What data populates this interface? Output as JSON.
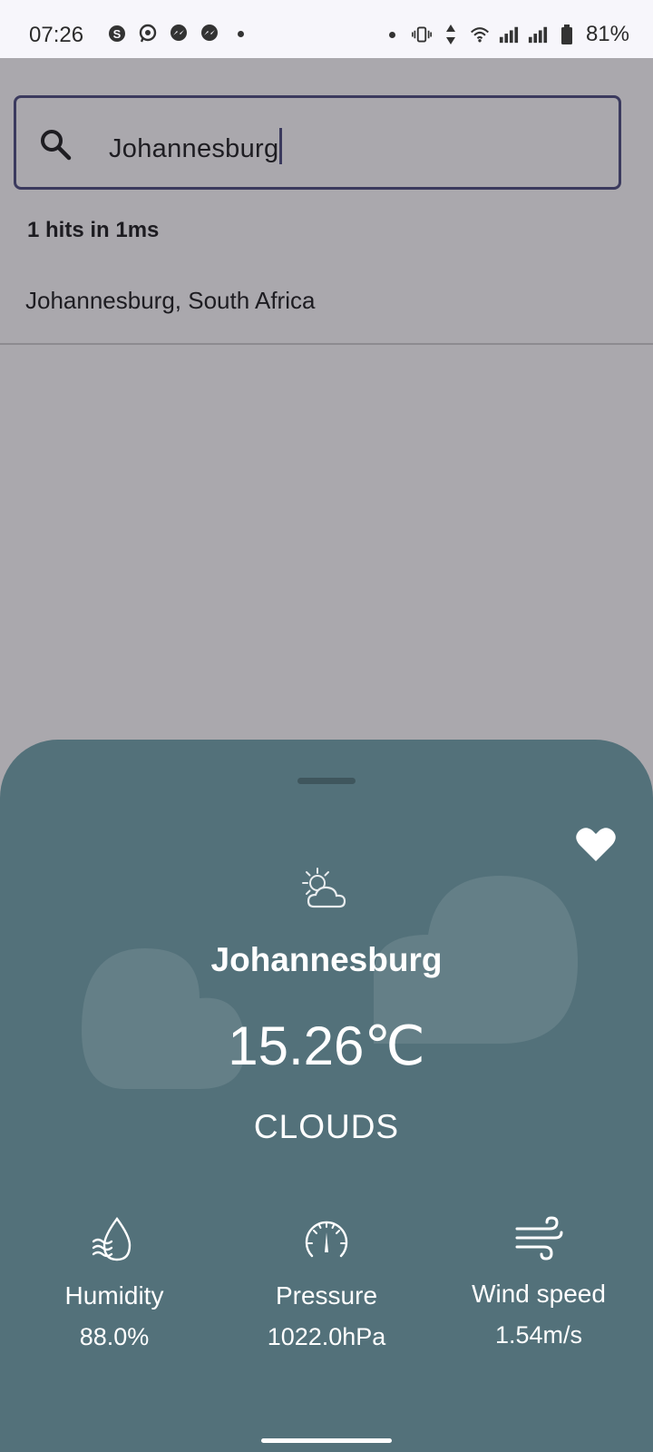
{
  "status_bar": {
    "time": "07:26",
    "left_icons": [
      "skype-icon",
      "whatsapp-icon",
      "messenger-icon",
      "messenger-icon",
      "dot"
    ],
    "right_icons": [
      "dot",
      "vibrate-icon",
      "data-arrows-icon",
      "wifi-icon",
      "signal-icon",
      "signal-icon",
      "battery-icon"
    ],
    "battery": "81%"
  },
  "search": {
    "value": "Johannesburg",
    "icon": "search-icon"
  },
  "results": {
    "hits": "1 hits in 1ms",
    "items": [
      {
        "label": "Johannesburg, South Africa"
      }
    ]
  },
  "weather": {
    "city": "Johannesburg",
    "temperature": "15.26℃",
    "condition": "CLOUDS",
    "condition_icon": "partly-cloudy-icon",
    "favorite_icon": "heart-icon",
    "metrics": [
      {
        "icon": "humidity-icon",
        "label": "Humidity",
        "value": "88.0%"
      },
      {
        "icon": "pressure-gauge-icon",
        "label": "Pressure",
        "value": "1022.0hPa"
      },
      {
        "icon": "wind-icon",
        "label": "Wind speed",
        "value": "1.54m/s"
      }
    ]
  },
  "colors": {
    "overlay_bg": "#aaa8ad",
    "sheet_bg": "#53717a",
    "search_border": "#3b3a5e"
  }
}
